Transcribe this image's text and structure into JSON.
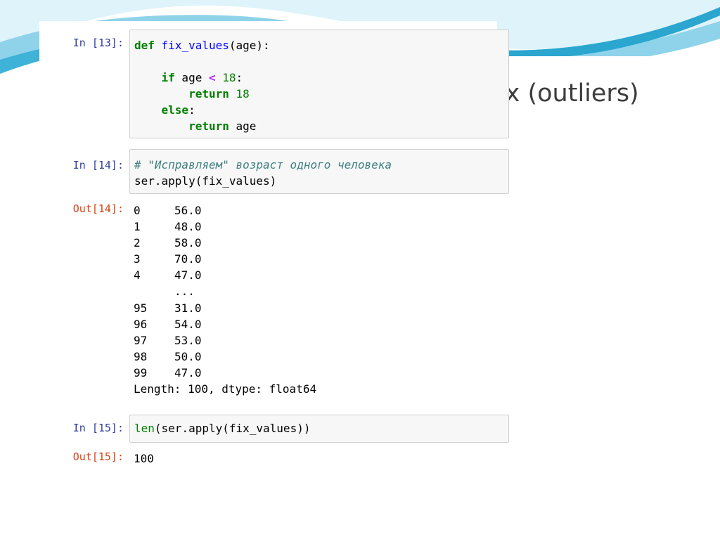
{
  "slide": {
    "title_fragment": "ых (outliers)",
    "colors": {
      "wave_light": "#b9e3f2",
      "wave_mid": "#5cc0e0",
      "wave_dark": "#2aa6cf"
    }
  },
  "notebook": {
    "cell13": {
      "prompt": "In [13]:",
      "code": {
        "l1_def": "def",
        "l1_name": "fix_values",
        "l1_rest": "(age):",
        "l2_if": "if",
        "l2_mid": " age ",
        "l2_op": "<",
        "l2_num": "18",
        "l2_end": ":",
        "l3_return": "return",
        "l3_num": "18",
        "l4_else": "else",
        "l4_end": ":",
        "l5_return": "return",
        "l5_rest": " age"
      }
    },
    "cell14": {
      "prompt": "In [14]:",
      "comment": "# \"Исправляем\" возраст одного человека",
      "code": "ser.apply(fix_values)",
      "out_prompt": "Out[14]:",
      "rows": [
        {
          "index": "0",
          "value": "56.0"
        },
        {
          "index": "1",
          "value": "48.0"
        },
        {
          "index": "2",
          "value": "58.0"
        },
        {
          "index": "3",
          "value": "70.0"
        },
        {
          "index": "4",
          "value": "47.0"
        },
        {
          "index": "",
          "value": "..."
        },
        {
          "index": "95",
          "value": "31.0"
        },
        {
          "index": "96",
          "value": "54.0"
        },
        {
          "index": "97",
          "value": "53.0"
        },
        {
          "index": "98",
          "value": "50.0"
        },
        {
          "index": "99",
          "value": "47.0"
        }
      ],
      "footer": "Length: 100, dtype: float64"
    },
    "cell15": {
      "prompt": "In [15]:",
      "code_fn": "len",
      "code_rest": "(ser.apply(fix_values))",
      "out_prompt": "Out[15]:",
      "output": "100"
    }
  }
}
